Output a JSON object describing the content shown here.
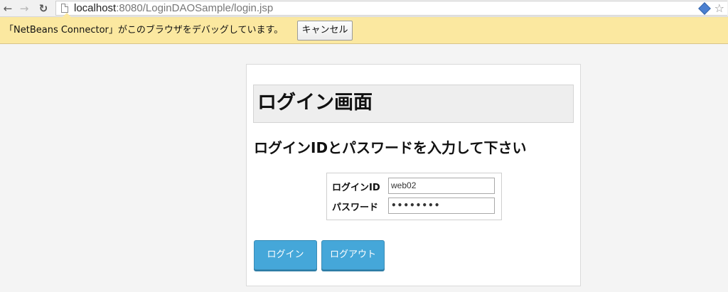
{
  "browser": {
    "url_host": "localhost",
    "url_rest": ":8080/LoginDAOSample/login.jsp"
  },
  "infobar": {
    "message": "「NetBeans Connector」がこのブラウザをデバッグしています。",
    "cancel_label": "キャンセル"
  },
  "page": {
    "title": "ログイン画面",
    "instruction": "ログインIDとパスワードを入力して下さい",
    "form": {
      "login_id_label": "ログインID",
      "login_id_value": "web02",
      "password_label": "パスワード",
      "password_value": "••••••••"
    },
    "buttons": {
      "login_label": "ログイン",
      "logout_label": "ログアウト"
    }
  },
  "colors": {
    "infobar_bg": "#fbe8a0",
    "button_bg": "#45a7d9"
  }
}
